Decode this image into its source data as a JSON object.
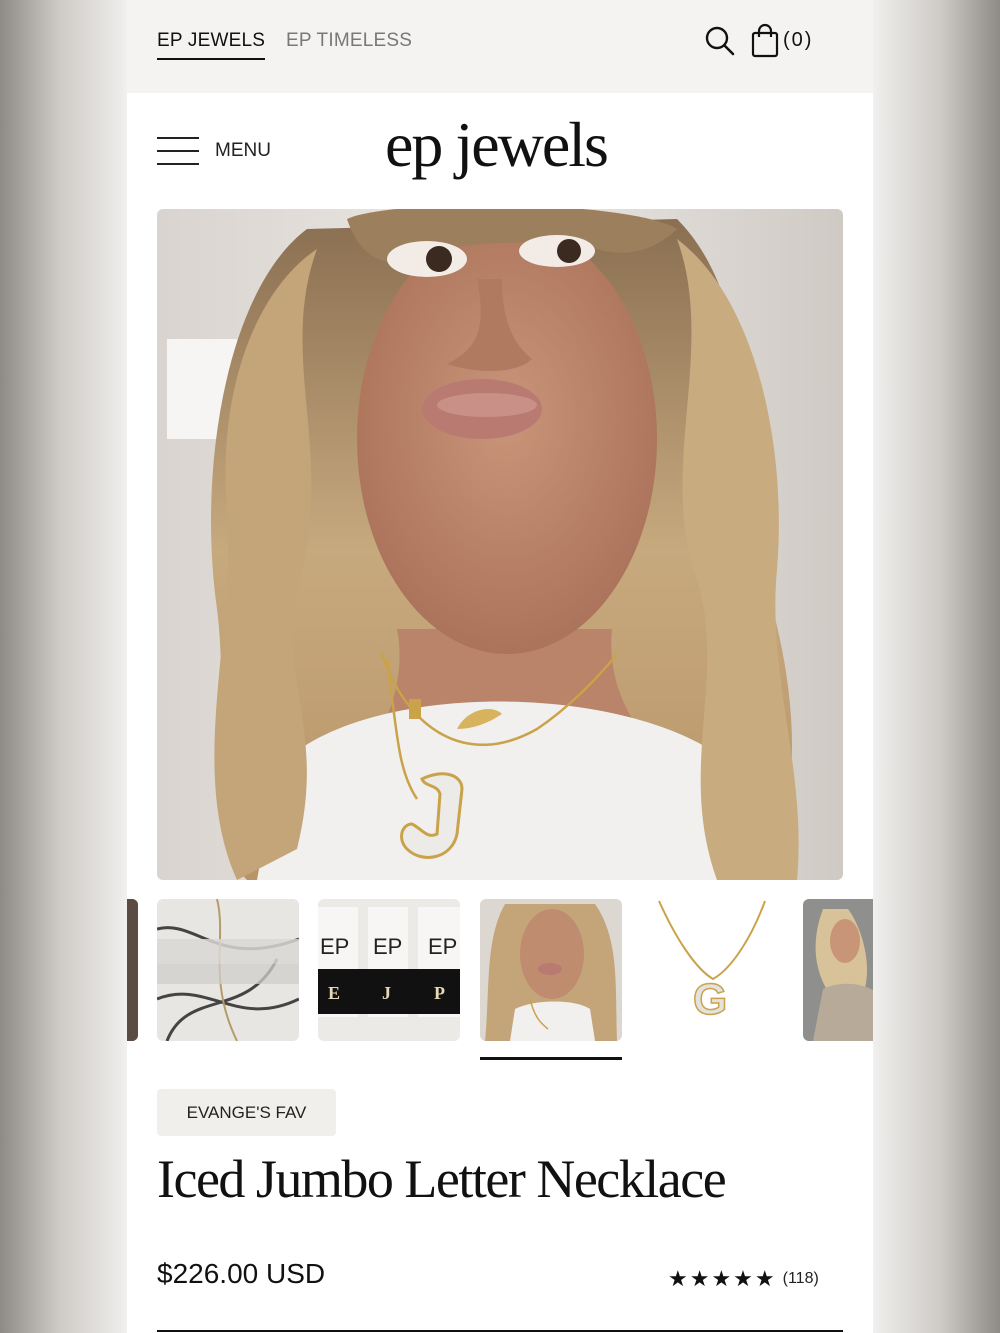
{
  "topbar": {
    "tabs": [
      {
        "label": "EP JEWELS",
        "active": true
      },
      {
        "label": "EP TIMELESS",
        "active": false
      }
    ],
    "cart_count": "(0)"
  },
  "header": {
    "menu_label": "MENU",
    "logo_text": "ep jewels"
  },
  "gallery": {
    "main_image": "woman-with-letter-J-necklace-photo",
    "thumbnails": [
      {
        "name": "partial-model-photo"
      },
      {
        "name": "iced-letters-on-marble-photo"
      },
      {
        "name": "EP-packaged-necklaces-photo"
      },
      {
        "name": "woman-kiss-face-photo",
        "selected": true
      },
      {
        "name": "letter-G-pendant-photo"
      },
      {
        "name": "woman-sequin-dress-photo"
      }
    ],
    "package_text": [
      "EP",
      "EP",
      "EP"
    ],
    "package_letters": [
      "E",
      "J",
      "P"
    ],
    "pendant_letter": "G"
  },
  "product": {
    "badge": "EVANGE'S FAV",
    "title": "Iced Jumbo Letter Necklace",
    "price": "$226.00 USD",
    "rating": 5,
    "stars": "★★★★★",
    "review_count": "(118)"
  },
  "colors": {
    "text": "#111111",
    "topbar_bg": "#f4f3f1",
    "badge_bg": "#f1efec",
    "accent_gold": "#c9a24a"
  }
}
